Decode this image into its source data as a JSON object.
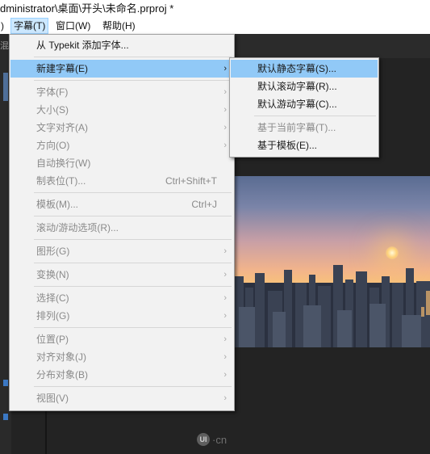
{
  "window": {
    "title": "dministrator\\桌面\\开头\\未命名.prproj *"
  },
  "menubar": {
    "items": [
      {
        "label": ")"
      },
      {
        "label": "字幕(T)"
      },
      {
        "label": "窗口(W)"
      },
      {
        "label": "帮助(H)"
      }
    ]
  },
  "title_menu": {
    "items": [
      {
        "label": "从 Typekit 添加字体..."
      },
      {
        "label": "新建字幕(E)"
      },
      {
        "label": "字体(F)"
      },
      {
        "label": "大小(S)"
      },
      {
        "label": "文字对齐(A)"
      },
      {
        "label": "方向(O)"
      },
      {
        "label": "自动换行(W)"
      },
      {
        "label": "制表位(T)...",
        "shortcut": "Ctrl+Shift+T"
      },
      {
        "label": "模板(M)...",
        "shortcut": "Ctrl+J"
      },
      {
        "label": "滚动/游动选项(R)..."
      },
      {
        "label": "图形(G)"
      },
      {
        "label": "变换(N)"
      },
      {
        "label": "选择(C)"
      },
      {
        "label": "排列(G)"
      },
      {
        "label": "位置(P)"
      },
      {
        "label": "对齐对象(J)"
      },
      {
        "label": "分布对象(B)"
      },
      {
        "label": "视图(V)"
      }
    ],
    "submenu_arrow": "›"
  },
  "new_title_submenu": {
    "items": [
      {
        "label": "默认静态字幕(S)..."
      },
      {
        "label": "默认滚动字幕(R)..."
      },
      {
        "label": "默认游动字幕(C)..."
      },
      {
        "label": "基于当前字幕(T)..."
      },
      {
        "label": "基于模板(E)..."
      }
    ]
  },
  "watermark": {
    "logo": "UI",
    "text": "·cn"
  },
  "left_panel": {
    "marker": "混"
  },
  "colors": {
    "menu_bg": "#f2f2f2",
    "highlight": "#91c9f7",
    "disabled_text": "#8a8a8a",
    "menubar_active": "#cce8ff"
  }
}
